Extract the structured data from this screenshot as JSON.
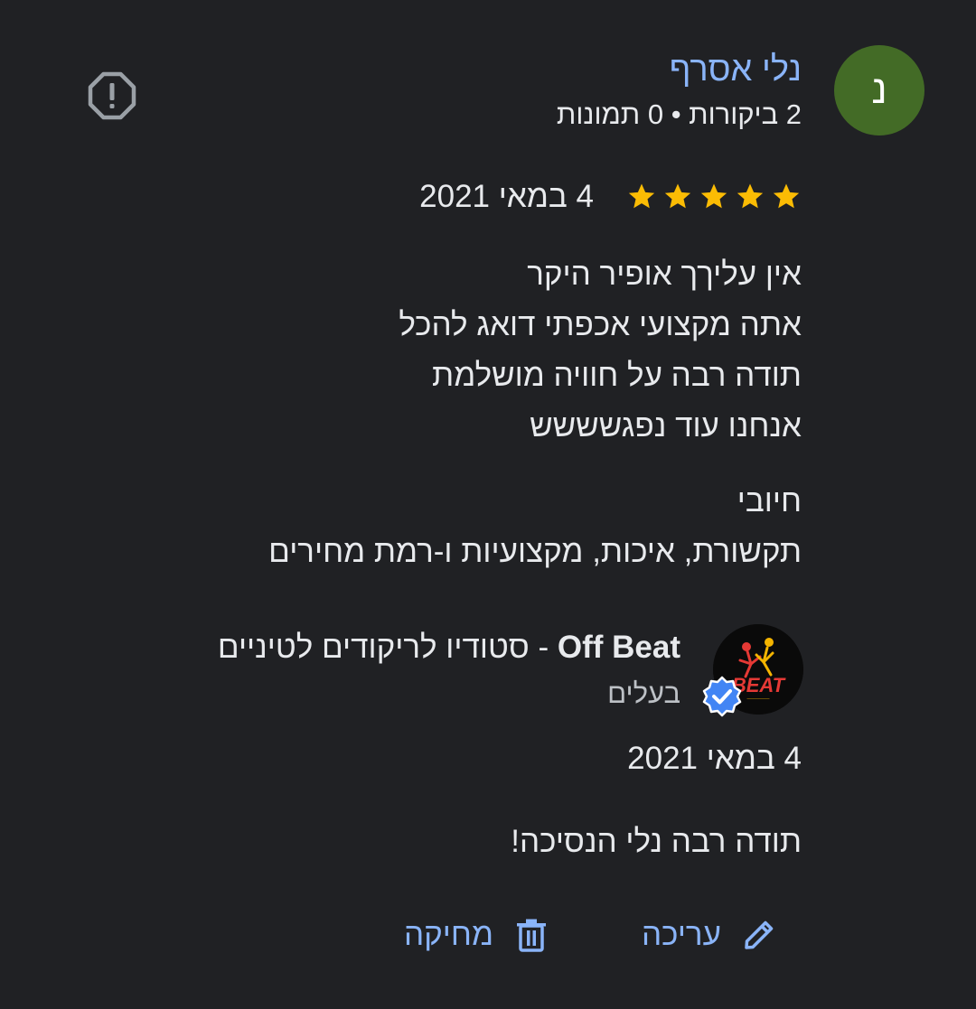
{
  "reviewer": {
    "avatar_letter": "נ",
    "avatar_color": "#436b26",
    "name": "נלי אסרף",
    "meta": "2 ביקורות • 0 תמונות",
    "report_icon": "report-icon"
  },
  "review": {
    "rating": 5,
    "max_rating": 5,
    "star_color": "#fbbc04",
    "date": "4 במאי 2021",
    "paragraphs": [
      {
        "lines": [
          "אין עליךך אופיר היקר",
          "אתה מקצועי אכפתי דואג להכל",
          "תודה רבה על חוויה מושלמת",
          "אנחנו עוד נפגשששש"
        ]
      },
      {
        "lines": [
          "חיובי",
          "תקשורת, איכות, מקצועיות ו-רמת מחירים"
        ]
      }
    ]
  },
  "owner_reply": {
    "name_latin": "Off Beat",
    "name_rest": " - סטודיו לריקודים לטיניים",
    "role": "בעלים",
    "logo_text": "BEAT",
    "verified_icon": "verified-badge-icon",
    "date": "4 במאי 2021",
    "text": "תודה רבה נלי הנסיכה!"
  },
  "actions": {
    "edit_label": "עריכה",
    "edit_icon": "pencil-icon",
    "delete_label": "מחיקה",
    "delete_icon": "trash-icon"
  },
  "colors": {
    "background": "#202124",
    "link": "#8ab4f8",
    "text": "#e8eaed",
    "verified": "#4285f4"
  }
}
